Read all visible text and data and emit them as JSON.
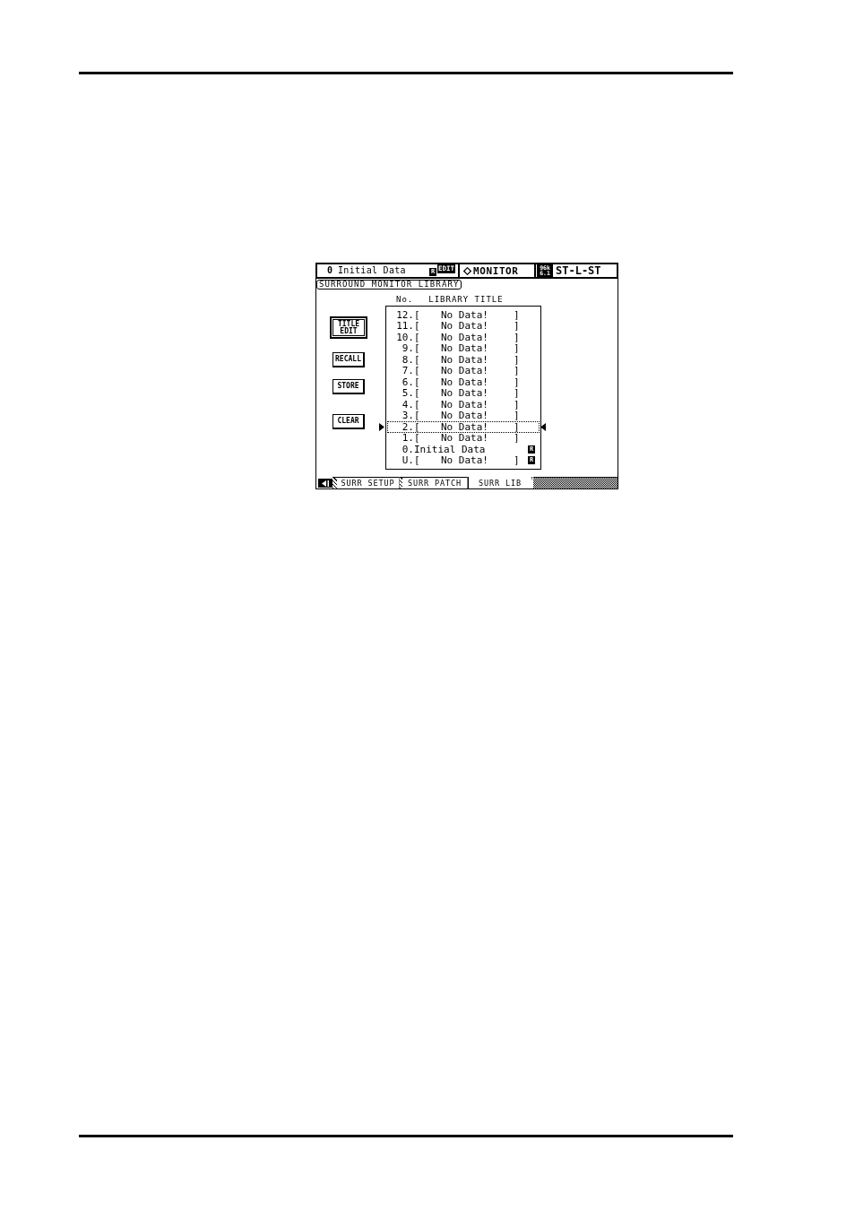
{
  "header": {
    "scene_number": "0",
    "scene_title": "Initial Data",
    "protect_badge": "R",
    "edit_badge": "EDIT",
    "page_name": "MONITOR",
    "format_badge": [
      "96k",
      "6.1"
    ],
    "monitor_mode": "ST-L-ST"
  },
  "section_title": "SURROUND MONITOR LIBRARY",
  "columns": [
    "No.",
    "LIBRARY TITLE"
  ],
  "buttons": [
    {
      "label": "TITLE EDIT",
      "kind": "popup"
    },
    {
      "label": "RECALL",
      "kind": "plain"
    },
    {
      "label": "STORE",
      "kind": "plain"
    },
    {
      "label": "CLEAR",
      "kind": "plain"
    }
  ],
  "library_rows": [
    {
      "number": "12.",
      "open_bracket": "[",
      "title": "No Data!",
      "close_bracket": "]",
      "selected": false
    },
    {
      "number": "11.",
      "open_bracket": "[",
      "title": "No Data!",
      "close_bracket": "]",
      "selected": false
    },
    {
      "number": "10.",
      "open_bracket": "[",
      "title": "No Data!",
      "close_bracket": "]",
      "selected": false
    },
    {
      "number": "9.",
      "open_bracket": "[",
      "title": "No Data!",
      "close_bracket": "]",
      "selected": false
    },
    {
      "number": "8.",
      "open_bracket": "[",
      "title": "No Data!",
      "close_bracket": "]",
      "selected": false
    },
    {
      "number": "7.",
      "open_bracket": "[",
      "title": "No Data!",
      "close_bracket": "]",
      "selected": false
    },
    {
      "number": "6.",
      "open_bracket": "[",
      "title": "No Data!",
      "close_bracket": "]",
      "selected": false
    },
    {
      "number": "5.",
      "open_bracket": "[",
      "title": "No Data!",
      "close_bracket": "]",
      "selected": false
    },
    {
      "number": "4.",
      "open_bracket": "[",
      "title": "No Data!",
      "close_bracket": "]",
      "selected": false
    },
    {
      "number": "3.",
      "open_bracket": "[",
      "title": "No Data!",
      "close_bracket": "]",
      "selected": false
    },
    {
      "number": "2.",
      "open_bracket": "[",
      "title": "No Data!",
      "close_bracket": "]",
      "selected": true
    },
    {
      "number": "1.",
      "open_bracket": "[",
      "title": "No Data!",
      "close_bracket": "]",
      "selected": false
    },
    {
      "number": "0.",
      "title": "Initial Data",
      "badge": "R",
      "selected": false
    },
    {
      "number": "U.",
      "open_bracket": "[",
      "title": "No Data!",
      "close_bracket": "]",
      "badge": "R",
      "selected": false
    }
  ],
  "tabs": [
    {
      "label": "SURR SETUP",
      "selected": false
    },
    {
      "label": "SURR PATCH",
      "selected": false
    },
    {
      "label": "SURR LIB",
      "selected": true
    }
  ]
}
